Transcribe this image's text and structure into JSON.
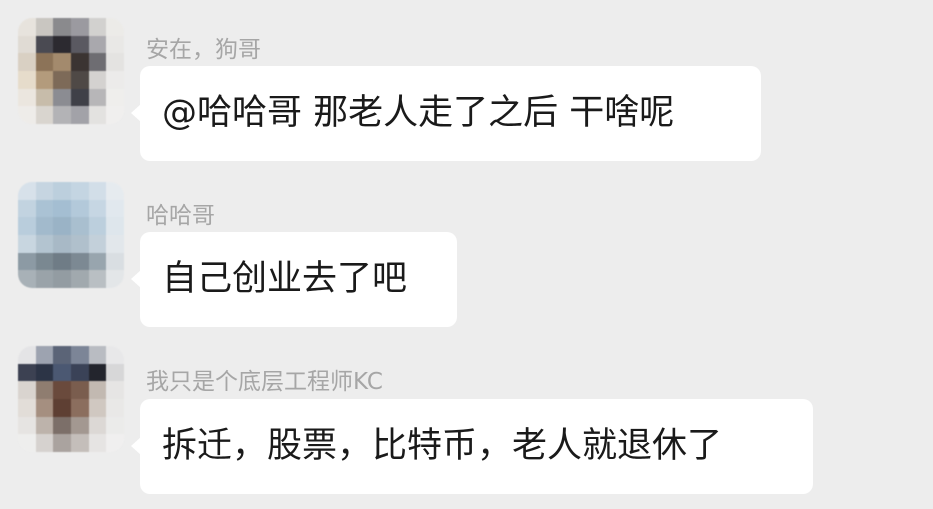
{
  "messages": [
    {
      "sender": "安在，狗哥",
      "text": "@哈哈哥  那老人走了之后 干啥呢",
      "avatar_palette": [
        "#e7e3dd",
        "#c9c6c1",
        "#8a8a8d",
        "#9b9aa0",
        "#d2d1cf",
        "#ecebe8",
        "#e0dbd4",
        "#4a4a52",
        "#2c2a30",
        "#5a5961",
        "#a9a8ad",
        "#e9e8e6",
        "#d9d0c3",
        "#8c7358",
        "#a38a6d",
        "#3b3432",
        "#6e6d72",
        "#e4e3e1",
        "#e6dccb",
        "#b39b7c",
        "#7d6a58",
        "#4f4946",
        "#d4d2d0",
        "#ecebea",
        "#ebe6df",
        "#c7bcaa",
        "#8b8c92",
        "#3f4048",
        "#b7b6b8",
        "#efeeec",
        "#eeece9",
        "#d9d5cf",
        "#b3b3b6",
        "#a2a2a8",
        "#e3e2e0",
        "#f0efee"
      ]
    },
    {
      "sender": "哈哈哥",
      "text": "自己创业去了吧",
      "avatar_palette": [
        "#d7e1ea",
        "#c6d5e1",
        "#bccfdd",
        "#c4d5e2",
        "#d2dee8",
        "#e6ebef",
        "#c2d3e0",
        "#aac2d4",
        "#a4bed2",
        "#b3c9da",
        "#c6d6e3",
        "#e1e8ee",
        "#b9cddc",
        "#a2bacc",
        "#9ab3c6",
        "#a9bfcf",
        "#bccfdd",
        "#dee6ec",
        "#c8d6e0",
        "#b3c4d0",
        "#a8b9c6",
        "#b0c0cc",
        "#c3d0da",
        "#e2e7eb",
        "#8c9aa4",
        "#7a8891",
        "#6f7c86",
        "#7c8993",
        "#98a5ae",
        "#d9dee2",
        "#a8b1b7",
        "#9aa3a9",
        "#939ca2",
        "#a1a9ae",
        "#b9bfc3",
        "#e3e6e8"
      ]
    },
    {
      "sender": "我只是个底层工程师KC",
      "text": "拆迁，股票，比特币，老人就退休了",
      "avatar_palette": [
        "#e4e4e6",
        "#9da3b0",
        "#5b6477",
        "#7c8597",
        "#b9bcc2",
        "#e8e8e9",
        "#3c4152",
        "#2c3446",
        "#4b5872",
        "#3a4257",
        "#23252d",
        "#d7d7d8",
        "#d9d4cf",
        "#8f7d70",
        "#6a4a3c",
        "#7a5d4e",
        "#c2b9b1",
        "#e6e5e4",
        "#e2ddd8",
        "#a58f80",
        "#5e3f33",
        "#8b6e5e",
        "#d0c8c1",
        "#e9e8e7",
        "#e6e4e2",
        "#bdb3ab",
        "#7c6f69",
        "#a39891",
        "#dcd8d5",
        "#ebebea",
        "#eeeeed",
        "#d6d2cf",
        "#aaa39f",
        "#c4beba",
        "#e6e4e3",
        "#f0efef"
      ]
    }
  ]
}
